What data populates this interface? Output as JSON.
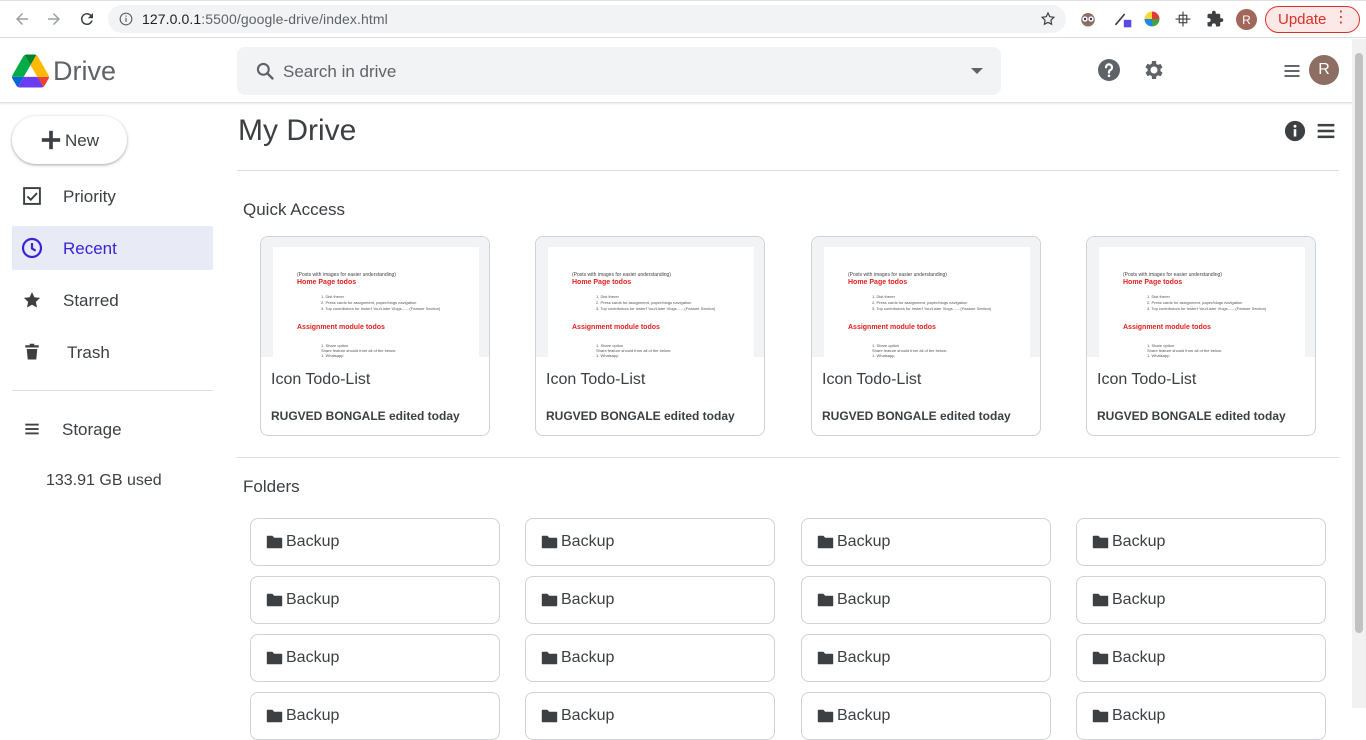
{
  "browser": {
    "url_host": "127.0.0.1",
    "url_path": ":5500/google-drive/index.html",
    "update_label": "Update",
    "profile_initial": "R"
  },
  "header": {
    "app_name": "Drive",
    "search_placeholder": "Search in drive",
    "avatar_initial": "R"
  },
  "sidebar": {
    "new_label": "New",
    "items": [
      {
        "label": "Priority",
        "icon": "checkbox-icon",
        "active": false
      },
      {
        "label": "Recent",
        "icon": "clock-icon",
        "active": true
      },
      {
        "label": "Starred",
        "icon": "star-icon",
        "active": false
      },
      {
        "label": "Trash",
        "icon": "trash-icon",
        "active": false
      }
    ],
    "storage_label": "Storage",
    "storage_used": "133.91 GB used"
  },
  "main": {
    "title": "My Drive",
    "quick_access_title": "Quick Access",
    "quick_access": [
      {
        "name": "Icon Todo-List",
        "meta": "RUGVED BONGALE edited today"
      },
      {
        "name": "Icon Todo-List",
        "meta": "RUGVED BONGALE edited today"
      },
      {
        "name": "Icon Todo-List",
        "meta": "RUGVED BONGALE edited today"
      },
      {
        "name": "Icon Todo-List",
        "meta": "RUGVED BONGALE edited today"
      }
    ],
    "doc_preview": {
      "line1": "(Posts with images for easier understanding)",
      "heading1": "Home Page todos",
      "items1": [
        "1. Dist therer",
        "2. Press cards for assignment, paper/blogs navigation",
        "3. Top contributors for Insterf You/Lister Vlogs.......(Feature Section)"
      ],
      "heading2": "Assignment module todos",
      "items2": [
        "1. Share option",
        "Share feature should from all of the below:",
        "1. Whatsapp"
      ]
    },
    "folders_title": "Folders",
    "folders": [
      "Backup",
      "Backup",
      "Backup",
      "Backup",
      "Backup",
      "Backup",
      "Backup",
      "Backup",
      "Backup",
      "Backup",
      "Backup",
      "Backup",
      "Backup",
      "Backup",
      "Backup",
      "Backup"
    ]
  },
  "colors": {
    "accent": "#3c21d8",
    "active_bg": "#e8eaf6",
    "update_red": "#d93025"
  }
}
